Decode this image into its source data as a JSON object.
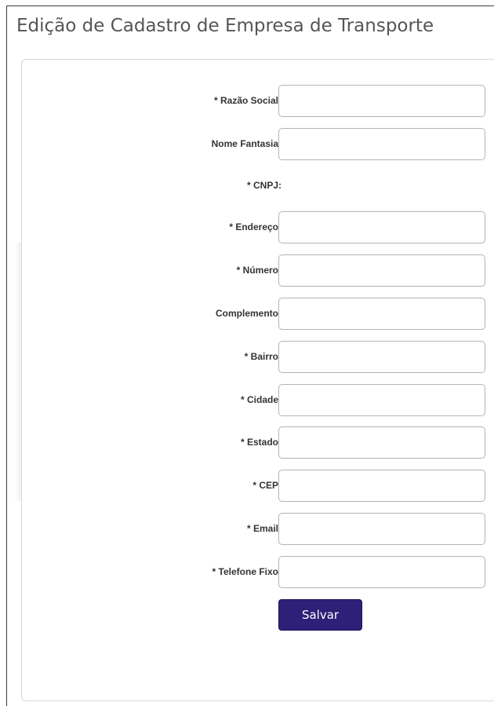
{
  "page": {
    "title": "Edição de Cadastro de Empresa de Transporte"
  },
  "form": {
    "fields": [
      {
        "label": "* Razão Social:",
        "value": "",
        "placeholder": ""
      },
      {
        "label": "Nome Fantasia:",
        "value": "",
        "placeholder": ""
      },
      {
        "label": "* CNPJ:",
        "value": "",
        "placeholder": ""
      },
      {
        "label": "* Endereço:",
        "value": "",
        "placeholder": ""
      },
      {
        "label": "* Número:",
        "value": "",
        "placeholder": ""
      },
      {
        "label": "Complemento:",
        "value": "",
        "placeholder": ""
      },
      {
        "label": "* Bairro:",
        "value": "",
        "placeholder": ""
      },
      {
        "label": "* Cidade:",
        "value": "",
        "placeholder": ""
      },
      {
        "label": "* Estado:",
        "value": "",
        "placeholder": ""
      },
      {
        "label": "* CEP:",
        "value": "",
        "placeholder": ""
      },
      {
        "label": "* Email:",
        "value": "",
        "placeholder": ""
      },
      {
        "label": "* Telefone Fixo:",
        "value": "",
        "placeholder": ""
      }
    ],
    "submit_label": "Salvar"
  },
  "colors": {
    "button_bg": "#2e1f78",
    "title_text": "#555555",
    "label_text": "#333333"
  }
}
